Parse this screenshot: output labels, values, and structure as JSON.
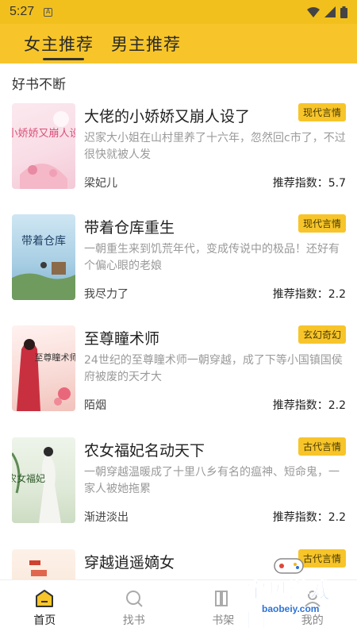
{
  "status_bar": {
    "time": "5:27",
    "sim_icon": "A"
  },
  "tabs": [
    {
      "label": "女主推荐",
      "active": true
    },
    {
      "label": "男主推荐",
      "active": false
    }
  ],
  "section_title": "好书不断",
  "books": [
    {
      "title": "大佬的小娇娇又崩人设了",
      "tag": "现代言情",
      "desc": "迟家大小姐在山村里养了十六年，忽然回c市了，不过很快就被人发",
      "author": "梁妃儿",
      "score_label": "推荐指数：",
      "score": "5.7",
      "cover_text": "小娇娇又崩人设"
    },
    {
      "title": "带着仓库重生",
      "tag": "现代言情",
      "desc": "一朝重生来到饥荒年代，变成传说中的极品！还好有个偏心眼的老娘",
      "author": "我尽力了",
      "score_label": "推荐指数：",
      "score": "2.2",
      "cover_text": "带着仓库"
    },
    {
      "title": "至尊瞳术师",
      "tag": "玄幻奇幻",
      "desc": "24世纪的至尊瞳术师一朝穿越，成了下等小国镇国侯府被废的天才大",
      "author": "陌烟",
      "score_label": "推荐指数：",
      "score": "2.2",
      "cover_text": "至尊瞳术师"
    },
    {
      "title": "农女福妃名动天下",
      "tag": "古代言情",
      "desc": "一朝穿越温暖成了十里八乡有名的瘟神、短命鬼，一家人被她拖累",
      "author": "渐进淡出",
      "score_label": "推荐指数：",
      "score": "2.2",
      "cover_text": "农女福妃"
    },
    {
      "title": "穿越逍遥嫡女",
      "tag": "古代言情",
      "desc": "",
      "author": "",
      "score_label": "",
      "score": "",
      "cover_text": ""
    }
  ],
  "bottom_nav": [
    {
      "label": "首页",
      "icon": "home-icon",
      "active": true
    },
    {
      "label": "找书",
      "icon": "search-icon",
      "active": false
    },
    {
      "label": "书架",
      "icon": "bookshelf-icon",
      "active": false
    },
    {
      "label": "我的",
      "icon": "profile-icon",
      "active": false
    }
  ],
  "watermark": {
    "text": "宝贝游戏网",
    "url": "baobeiy.com"
  },
  "colors": {
    "brand_yellow": "#f7c52a",
    "status_yellow": "#f2c01d",
    "watermark_blue": "#2c73d9"
  }
}
